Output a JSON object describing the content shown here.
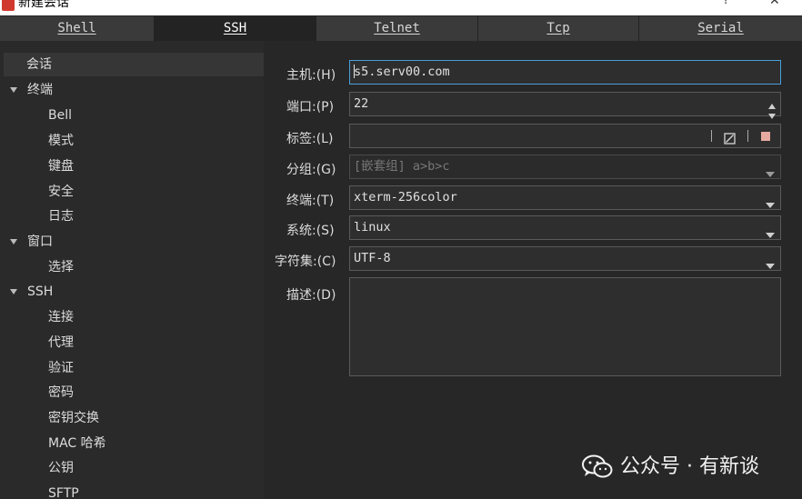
{
  "window": {
    "title": "新建会话",
    "help_label": "?",
    "close_label": "✕",
    "icon": "app-icon"
  },
  "tabs": [
    {
      "label": "Shell",
      "active": false
    },
    {
      "label": "SSH",
      "active": true
    },
    {
      "label": "Telnet",
      "active": false
    },
    {
      "label": "Tcp",
      "active": false
    },
    {
      "label": "Serial",
      "active": false
    }
  ],
  "sidebar": {
    "items": [
      {
        "label": "会话",
        "selected": true
      },
      {
        "label": "终端",
        "expandable": true
      },
      {
        "label": "Bell"
      },
      {
        "label": "模式"
      },
      {
        "label": "键盘"
      },
      {
        "label": "安全"
      },
      {
        "label": "日志"
      },
      {
        "label": "窗口",
        "expandable": true
      },
      {
        "label": "选择"
      },
      {
        "label": "SSH",
        "expandable": true
      },
      {
        "label": "连接"
      },
      {
        "label": "代理"
      },
      {
        "label": "验证"
      },
      {
        "label": "密码"
      },
      {
        "label": "密钥交换"
      },
      {
        "label": "MAC 哈希"
      },
      {
        "label": "公钥"
      },
      {
        "label": "SFTP"
      }
    ]
  },
  "form": {
    "host": {
      "label": "主机:(H)",
      "value": "s5.serv00.com"
    },
    "port": {
      "label": "端口:(P)",
      "value": "22"
    },
    "tag": {
      "label": "标签:(L)",
      "value": "",
      "edit_icon": "clear-box-icon",
      "color_icon": "color-square-icon",
      "color": "#e6a9a0"
    },
    "group": {
      "label": "分组:(G)",
      "placeholder": "[嵌套组] a>b>c"
    },
    "terminal": {
      "label": "终端:(T)",
      "value": "xterm-256color"
    },
    "system": {
      "label": "系统:(S)",
      "value": "linux"
    },
    "charset": {
      "label": "字符集:(C)",
      "value": "UTF-8"
    },
    "description": {
      "label": "描述:(D)",
      "value": ""
    }
  },
  "watermark": {
    "text": "公众号 · 有新谈",
    "icon": "wechat-icon"
  },
  "colors": {
    "accent": "#4a9fd8",
    "background": "#272727",
    "sidebar": "#2a2a2a"
  }
}
